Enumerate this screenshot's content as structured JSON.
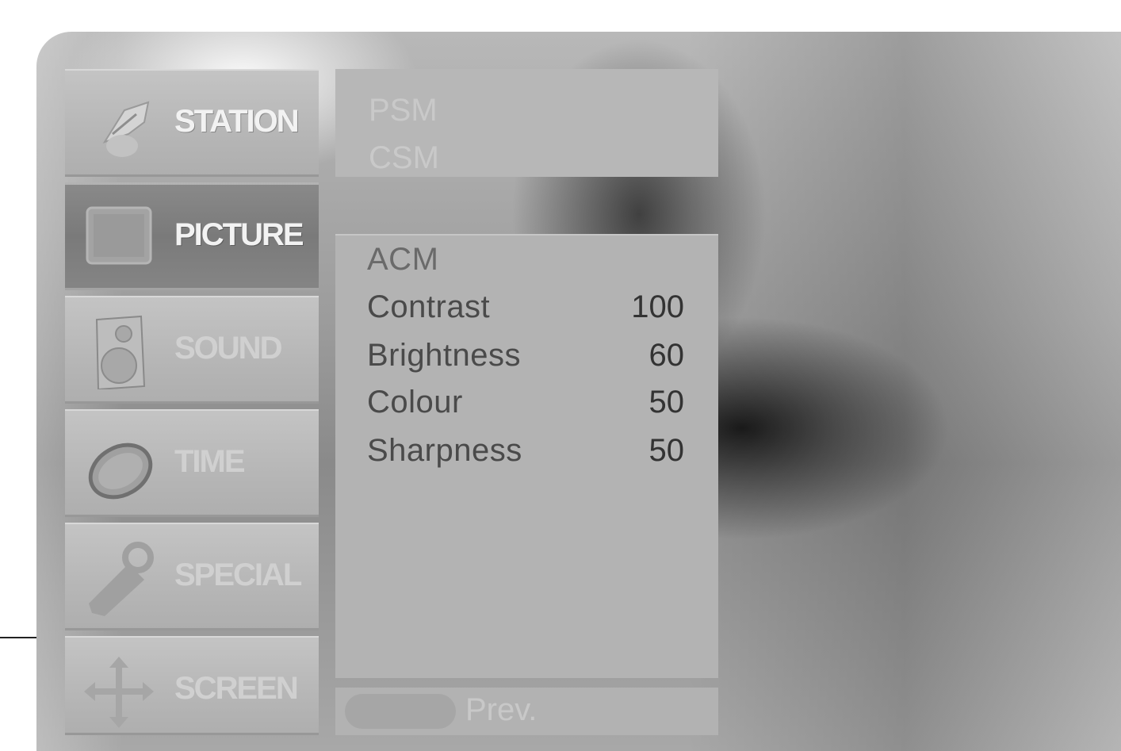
{
  "menu": {
    "items": [
      {
        "id": "station",
        "label": "STATION",
        "icon": "satellite-dish-icon"
      },
      {
        "id": "picture",
        "label": "PICTURE",
        "icon": "tv-screen-icon",
        "selected": true
      },
      {
        "id": "sound",
        "label": "SOUND",
        "icon": "speaker-icon"
      },
      {
        "id": "time",
        "label": "TIME",
        "icon": "clock-icon"
      },
      {
        "id": "special",
        "label": "SPECIAL",
        "icon": "tag-icon"
      },
      {
        "id": "screen",
        "label": "SCREEN",
        "icon": "move-arrows-icon"
      }
    ]
  },
  "submenu": {
    "items": [
      "PSM",
      "CSM"
    ]
  },
  "picture_settings": {
    "acm_label": "ACM",
    "rows": [
      {
        "name": "Contrast",
        "value": "100"
      },
      {
        "name": "Brightness",
        "value": "60"
      },
      {
        "name": "Colour",
        "value": "50"
      },
      {
        "name": "Sharpness",
        "value": "50"
      }
    ]
  },
  "footer": {
    "prev_label": "Prev."
  },
  "colors": {
    "panel_gray": "#b3b3b3",
    "selected_gray": "#7a7a7a"
  }
}
